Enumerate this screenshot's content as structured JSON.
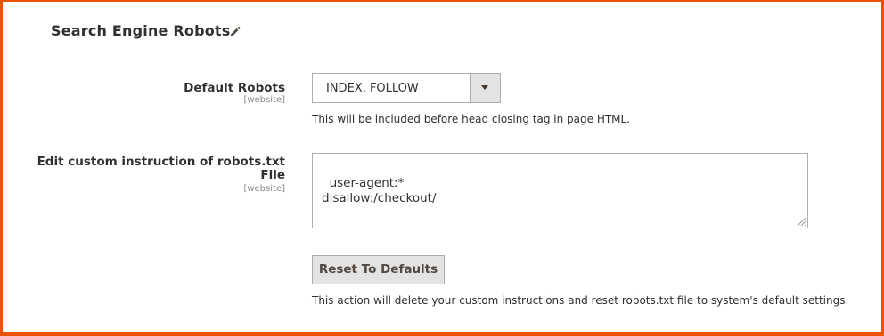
{
  "section": {
    "title": "Search Engine Robots"
  },
  "default_robots": {
    "label": "Default Robots",
    "scope": "[website]",
    "selected": "INDEX, FOLLOW",
    "note": "This will be included before head closing tag in page HTML."
  },
  "custom_instruction": {
    "label_line1": "Edit custom instruction of robots.txt",
    "label_line2": "File",
    "scope": "[website]",
    "value": "user-agent:*\ndisallow:/checkout/"
  },
  "reset": {
    "button_label": "Reset To Defaults",
    "note": "This action will delete your custom instructions and reset robots.txt file to system's default settings."
  },
  "colors": {
    "border": "#eb5202",
    "button_bg": "#e3e3e3"
  },
  "icons": [
    "pencil-icon",
    "chevron-down-icon",
    "resize-grip-icon"
  ]
}
